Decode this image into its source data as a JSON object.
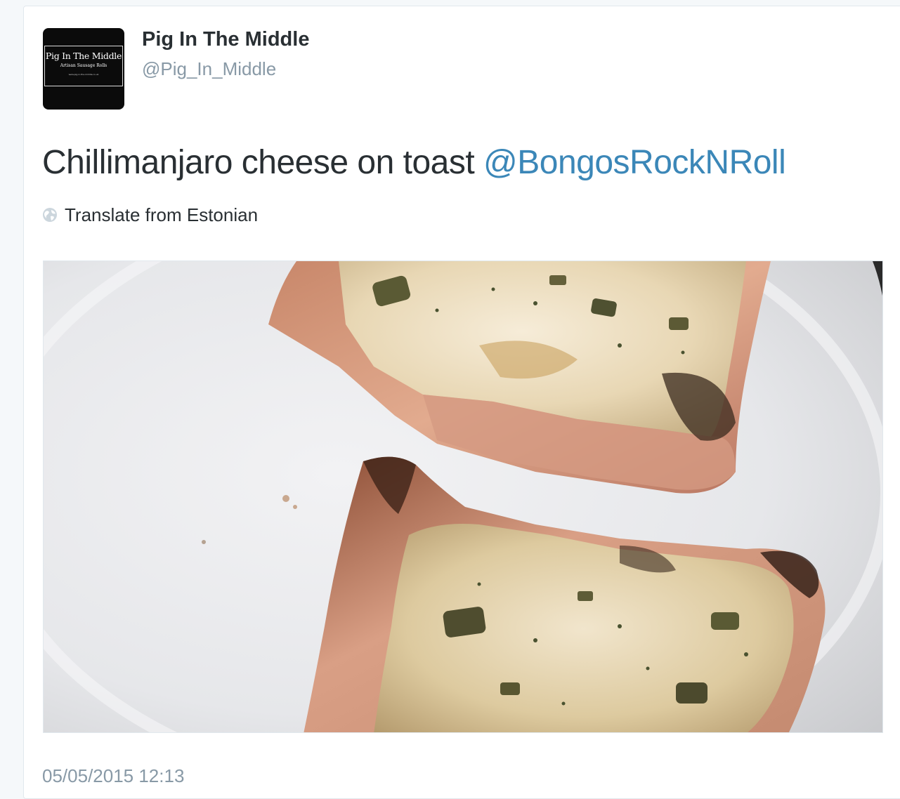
{
  "tweet": {
    "author": {
      "display_name": "Pig In The Middle",
      "screen_name": "@Pig_In_Middle",
      "avatar": {
        "logo_title": "Pig In The Middle",
        "logo_subtitle": "Artisan Sausage Rolls",
        "logo_url": "www.pig-in-the-middle.co.uk"
      }
    },
    "text": "Chillimanjaro cheese on toast",
    "mention": "@BongosRockNRoll",
    "translate": {
      "icon": "globe-icon",
      "label": "Translate from Estonian"
    },
    "photo": {
      "subject": "cheese-on-toast-photo"
    },
    "timestamp": "05/05/2015 12:13"
  },
  "colors": {
    "text": "#292f33",
    "muted": "#8899a6",
    "link": "#3b87b8",
    "border": "#e1e8ed"
  }
}
